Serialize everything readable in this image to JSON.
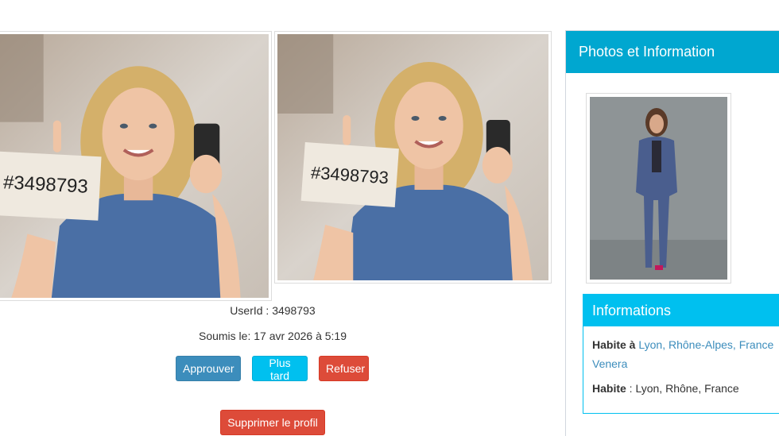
{
  "photos": {
    "sign_text": "#3498793"
  },
  "meta": {
    "userid_label": "UserId : 3498793",
    "submitted_label": "Soumis le: 17 avr 2026 à 5:19"
  },
  "actions": {
    "approve": "Approuver",
    "later": "Plus tard",
    "refuse": "Refuser",
    "delete": "Supprimer le profil"
  },
  "side": {
    "title": "Photos et Information"
  },
  "info": {
    "title": "Informations",
    "lives_label": "Habite à",
    "lives_value": "Lyon, Rhône-Alpes, France",
    "lives_extra": "Venera",
    "habite_label": "Habite",
    "habite_value": " : Lyon, Rhône, France"
  },
  "colors": {
    "primary": "#3c8dbc",
    "info": "#00c0ef",
    "danger": "#dd4b39",
    "header": "#00a7d0"
  }
}
